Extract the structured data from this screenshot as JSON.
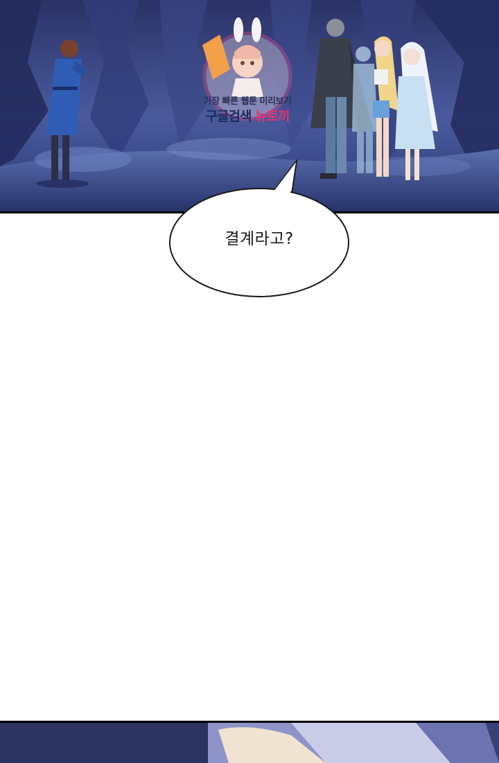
{
  "watermark": {
    "line1": "가장 빠른 웹툰 미리보기",
    "line2_main": "구글검색 ",
    "line2_highlight": "뉴토끼"
  },
  "dialogue": {
    "text": "결계라고?"
  },
  "colors": {
    "cave_dark": "#1c2450",
    "cave_mid": "#3b4a8a",
    "cave_light": "#7c8fc8",
    "watermark_ring": "#e84b8a",
    "watermark_accent": "#e5326e",
    "panel_border": "#000000"
  }
}
